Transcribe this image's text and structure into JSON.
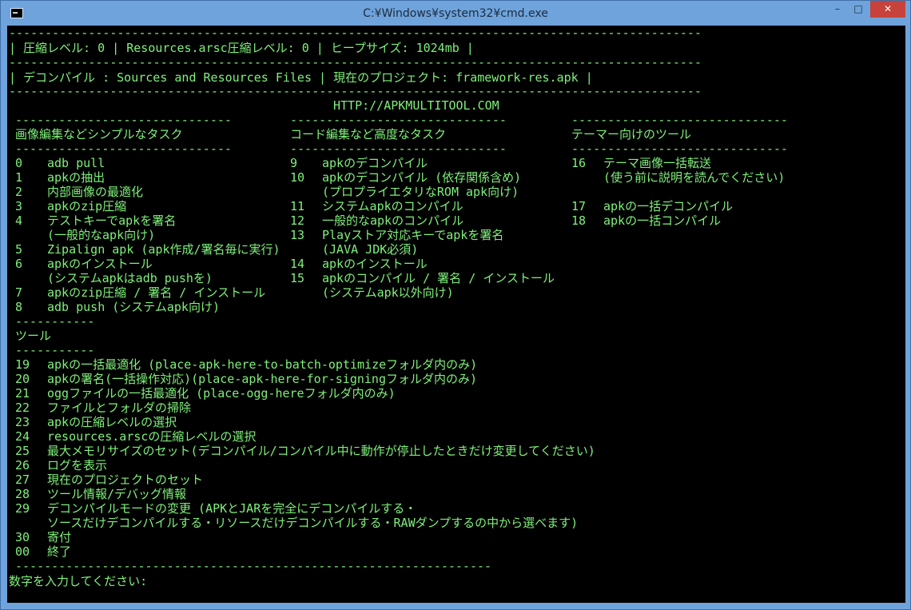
{
  "window": {
    "title": "C:¥Windows¥system32¥cmd.exe",
    "minimize": "–",
    "maximize": "□",
    "close": "✕"
  },
  "colors": {
    "console_bg": "#000000",
    "console_text": "#7ff07a",
    "titlebar": "#6ea3dc",
    "close": "#c7423a"
  },
  "header": {
    "sep1": "------------------------------------------------------------------------------------------------",
    "status": "| 圧縮レベル: 0 | Resources.arsc圧縮レベル: 0 | ヒープサイズ: 1024mb |",
    "sep2": "------------------------------------------------------------------------------------------------",
    "project": "| デコンパイル : Sources and Resources Files | 現在のプロジェクト: framework-res.apk |",
    "sep3": "------------------------------------------------------------------------------------------------",
    "url": "HTTP://APKMULTITOOL.COM"
  },
  "columns": {
    "col1": {
      "sep": "------------------------------",
      "title": "画像編集などシンプルなタスク",
      "sep2": "------------------------------"
    },
    "col2": {
      "sep": "------------------------------",
      "title": "コード編集など高度なタスク",
      "sep2": "------------------------------"
    },
    "col3": {
      "sep": "------------------------------",
      "title": "テーマー向けのツール",
      "sep2": "------------------------------"
    }
  },
  "simple_tasks": [
    {
      "num": "0",
      "label": "adb pull"
    },
    {
      "num": "1",
      "label": "apkの抽出"
    },
    {
      "num": "2",
      "label": "内部画像の最適化"
    },
    {
      "num": "3",
      "label": "apkのzip圧縮"
    },
    {
      "num": "4",
      "label": "テストキーでapkを署名"
    },
    {
      "num": "",
      "label": "(一般的なapk向け)"
    },
    {
      "num": "5",
      "label": "Zipalign apk (apk作成/署名毎に実行)"
    },
    {
      "num": "6",
      "label": "apkのインストール"
    },
    {
      "num": "",
      "label": "(システムapkはadb pushを)"
    },
    {
      "num": "7",
      "label": "apkのzip圧縮 / 署名 / インストール"
    },
    {
      "num": "8",
      "label": "adb push (システムapk向け)"
    }
  ],
  "advanced_tasks": [
    {
      "num": "9",
      "label": "apkのデコンパイル"
    },
    {
      "num": "10",
      "label": "apkのデコンパイル (依存関係含め)"
    },
    {
      "num": "",
      "label": "(プロプライエタリなROM apk向け)"
    },
    {
      "num": "11",
      "label": "システムapkのコンパイル"
    },
    {
      "num": "12",
      "label": "一般的なapkのコンパイル"
    },
    {
      "num": "13",
      "label": "Playストア対応キーでapkを署名"
    },
    {
      "num": "",
      "label": "(JAVA JDK必須)"
    },
    {
      "num": "14",
      "label": "apkのインストール"
    },
    {
      "num": "15",
      "label": "apkのコンパイル / 署名 / インストール"
    },
    {
      "num": "",
      "label": "(システムapk以外向け)"
    }
  ],
  "themer_tools": [
    {
      "num": "16",
      "label": "テーマ画像一括転送"
    },
    {
      "num": "",
      "label": "(使う前に説明を読んでください)"
    },
    {
      "num": "17",
      "label": "apkの一括デコンパイル"
    },
    {
      "num": "18",
      "label": "apkの一括コンパイル"
    }
  ],
  "tools": {
    "sep_top": "-----------",
    "title": "ツール",
    "sep_bottom": "-----------",
    "items": [
      {
        "num": "19",
        "label": "apkの一括最適化 (place-apk-here-to-batch-optimizeフォルダ内のみ)"
      },
      {
        "num": "20",
        "label": "apkの署名(一括操作対応)(place-apk-here-for-signingフォルダ内のみ)"
      },
      {
        "num": "21",
        "label": "oggファイルの一括最適化 (place-ogg-hereフォルダ内のみ)"
      },
      {
        "num": "22",
        "label": "ファイルとフォルダの掃除"
      },
      {
        "num": "23",
        "label": "apkの圧縮レベルの選択"
      },
      {
        "num": "24",
        "label": "resources.arscの圧縮レベルの選択"
      },
      {
        "num": "25",
        "label": "最大メモリサイズのセット(デコンパイル/コンパイル中に動作が停止したときだけ変更してください)"
      },
      {
        "num": "26",
        "label": "ログを表示"
      },
      {
        "num": "27",
        "label": "現在のプロジェクトのセット"
      },
      {
        "num": "28",
        "label": "ツール情報/デバッグ情報"
      },
      {
        "num": "29",
        "label": "デコンパイルモードの変更 (APKとJARを完全にデコンパイルする・"
      },
      {
        "num": "",
        "label": "ソースだけデコンパイルする・リソースだけデコンパイルする・RAWダンプするの中から選べます)"
      },
      {
        "num": "30",
        "label": "寄付"
      },
      {
        "num": "00",
        "label": "終了"
      }
    ],
    "sep_end": "------------------------------------------------------------------"
  },
  "prompt": "数字を入力してください:"
}
